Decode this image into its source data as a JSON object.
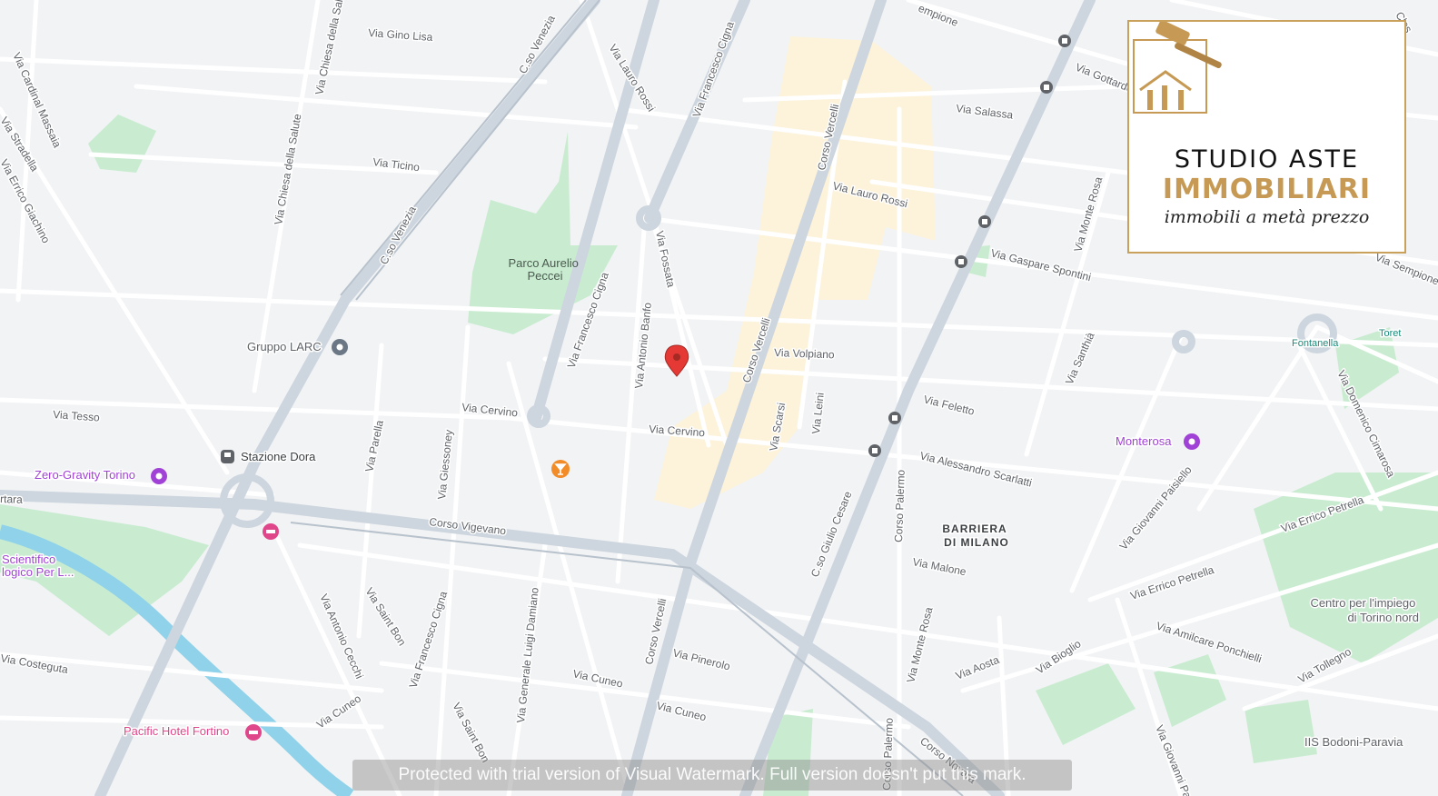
{
  "map": {
    "streets": [
      "Via Gino Lisa",
      "Via Chiesa della Salute",
      "C.so Venezia",
      "Via Lauro Rossi",
      "Via Francesco Cigna",
      "Corso Vercelli",
      "Via Salassa",
      "Via Gottardo",
      "Via Cardinal Massaia",
      "Via Stradella",
      "Via Errico Giachino",
      "Via Ticino",
      "Via Fossata",
      "Via Gaspare Spontini",
      "Via Monte Rosa",
      "Via Sempione",
      "Via Antonio Banfo",
      "Via Volpiano",
      "Via Cervino",
      "Via Tesso",
      "Via Parella",
      "Via Giessoney",
      "Via Scarsi",
      "Via Leini",
      "Via Feletto",
      "Via Alessandro Scarlatti",
      "Corso Vigevano",
      "C.so Giulio Cesare",
      "Corso Palermo",
      "Via Malone",
      "Via Santhià",
      "Via Domenico Cimarosa",
      "Via Giovanni Paisiello",
      "Via Errico Petrella",
      "Via Amilcare Ponchielli",
      "Via Tollegno",
      "Via Antonio Cecchi",
      "Via Saint Bon",
      "Via Generale Luigi Damiano",
      "Via Pinerolo",
      "Via Cuneo",
      "Via Aosta",
      "Via Bioglio",
      "Corso Novara",
      "Via Costeguta",
      "Via Giovanni Pacini"
    ],
    "pois": {
      "parco": "Parco Aurelio Peccei",
      "larc": "Gruppo LARC",
      "stazione": "Stazione Dora",
      "zero": "Zero-Gravity Torino",
      "pacific": "Pacific Hotel Fortino",
      "monterosa": "Monterosa",
      "fontanella": "Fontanella",
      "toret": "Toret",
      "centro": "Centro per l'impiego di Torino nord",
      "bodoni": "IIS Bodoni-Paravia",
      "scientifico": "Scientifico Biologico Per L..."
    },
    "district": "BARRIERA DI MILANO",
    "district_lines": [
      "BARRIERA",
      "DI MILANO"
    ],
    "parco_lines": [
      "Parco Aurelio",
      "Peccei"
    ],
    "centro_lines": [
      "Centro per l'impiego",
      "di Torino nord"
    ],
    "scientifico_lines": [
      "Scientifico",
      "logico Per L..."
    ],
    "edge_labels": {
      "artara": "rtara",
      "empione": "empione",
      "cles": "Cles"
    },
    "colors": {
      "park": "#c9ecd1",
      "water": "#8fd2e9",
      "road": "#ffffff",
      "highway": "#cdd5de",
      "market": "#fdf2d9",
      "pin": "#e53935",
      "transit": "#5f6368",
      "poi_purple": "#a142d6",
      "poi_pink": "#e0468a",
      "bar_orange": "#f28c28"
    }
  },
  "logo": {
    "line1": "STUDIO ASTE",
    "line2": "IMMOBILIARI",
    "tagline": "immobili a metà prezzo",
    "brand_color": "#c69a55"
  },
  "watermark": {
    "text": "Protected with trial version of Visual Watermark. Full version doesn't put this mark."
  }
}
